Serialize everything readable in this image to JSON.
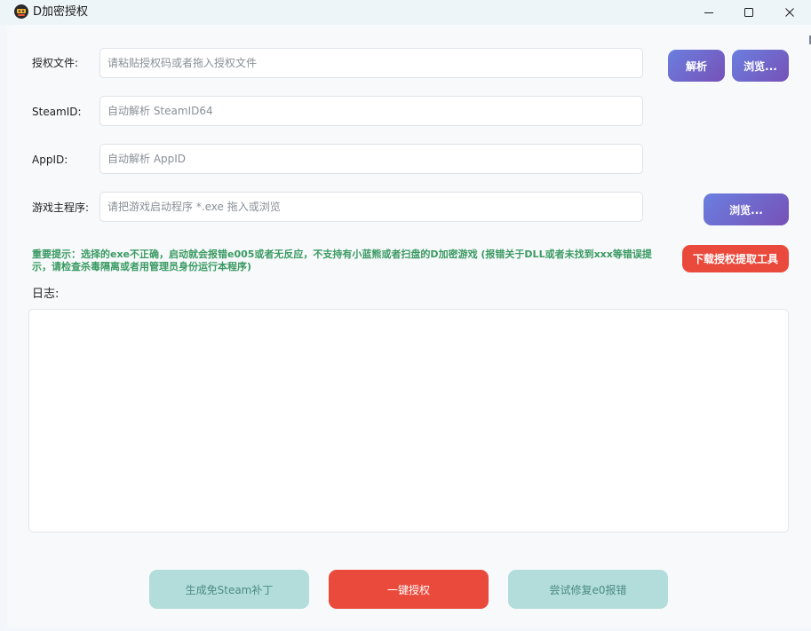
{
  "window": {
    "title": "D加密授权"
  },
  "form": {
    "license_file": {
      "label": "授权文件:",
      "placeholder": "请粘贴授权码或者拖入授权文件",
      "value": ""
    },
    "steam_id": {
      "label": "SteamID:",
      "placeholder": "自动解析 SteamID64",
      "value": ""
    },
    "app_id": {
      "label": "AppID:",
      "placeholder": "自动解析 AppID",
      "value": ""
    },
    "game_exe": {
      "label": "游戏主程序:",
      "placeholder": "请把游戏启动程序 *.exe 拖入或浏览",
      "value": ""
    }
  },
  "buttons": {
    "parse": "解析",
    "browse_license": "浏览...",
    "browse_exe": "浏览...",
    "download_tool": "下载授权提取工具",
    "generate_patch": "生成免Steam补丁",
    "one_click_auth": "一键授权",
    "fix_e0": "尝试修复e0报错"
  },
  "notice": {
    "text": "重要提示：选择的exe不正确，启动就会报错e005或者无反应，不支持有小蓝熊或者扫盘的D加密游戏 (报错关于DLL或者未找到xxx等错误提示，请检查杀毒隔离或者用管理员身份运行本程序)"
  },
  "log": {
    "label": "日志:",
    "content": ""
  },
  "colors": {
    "accent_purple_start": "#6b7fe0",
    "accent_purple_end": "#7651b7",
    "danger_red": "#ea4a3c",
    "muted_teal": "#b2ddda",
    "notice_green": "#3a9a62"
  }
}
